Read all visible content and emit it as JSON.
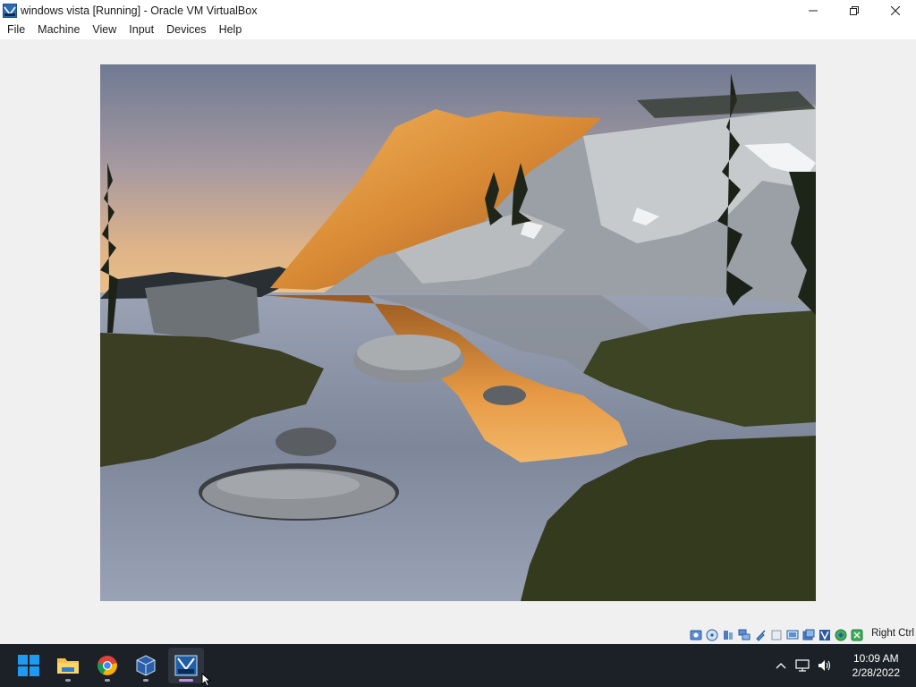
{
  "window": {
    "title": "windows vista [Running] - Oracle VM VirtualBox",
    "icon": "virtualbox-vm-icon",
    "controls": [
      "minimize-icon",
      "restore-icon",
      "close-icon"
    ]
  },
  "menubar": {
    "items": [
      {
        "label": "File"
      },
      {
        "label": "Machine"
      },
      {
        "label": "View"
      },
      {
        "label": "Input"
      },
      {
        "label": "Devices"
      },
      {
        "label": "Help"
      }
    ]
  },
  "vm_screen": {
    "content": "wallpaper-image"
  },
  "statusbar": {
    "icons": [
      "hard-disk-icon",
      "optical-drive-icon",
      "audio-icon",
      "network-icon",
      "usb-icon",
      "shared-folders-icon",
      "display-icon",
      "recording-icon",
      "vt-x-icon",
      "cpu-icon",
      "mouse-integration-icon",
      "keyboard-capture-icon"
    ],
    "host_key_label": "Right Ctrl"
  },
  "taskbar": {
    "apps": [
      {
        "name": "start-button",
        "icon": "windows-logo-icon"
      },
      {
        "name": "file-explorer",
        "icon": "folder-icon"
      },
      {
        "name": "google-chrome",
        "icon": "chrome-icon"
      },
      {
        "name": "virtualbox-manager",
        "icon": "virtualbox-icon"
      },
      {
        "name": "windows-vista-vm",
        "icon": "vista-vm-icon",
        "active": true
      }
    ],
    "tray_icons": [
      "chevron-up-icon",
      "network-icon",
      "volume-icon"
    ],
    "clock": {
      "time": "10:09 AM",
      "date": "2/28/2022"
    }
  },
  "colors": {
    "taskbar_bg": "#1c2128",
    "active_indicator": "#c58af0",
    "window_bg": "#f0f0f0"
  }
}
